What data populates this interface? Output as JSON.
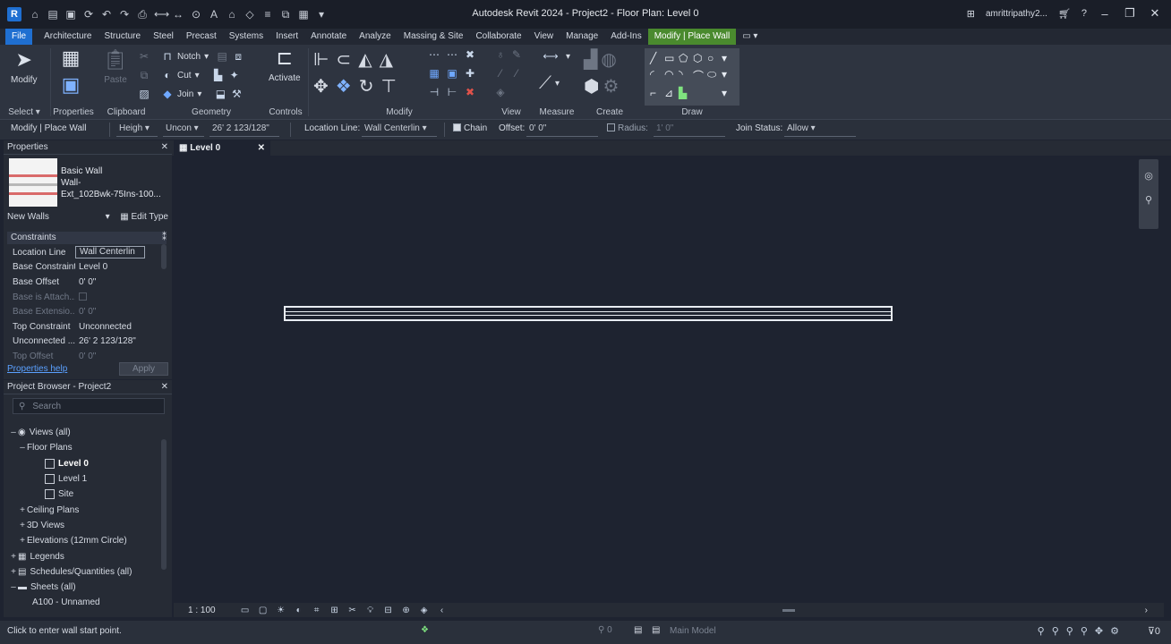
{
  "titlebar": {
    "logo": "R",
    "title": "Autodesk Revit 2024 - Project2 - Floor Plan: Level 0",
    "user": "amrittripathy2...",
    "qat_icons": [
      "open-icon",
      "save-icon",
      "sync-icon",
      "undo-icon",
      "redo-icon",
      "print-icon",
      "measure-icon",
      "text-icon",
      "home-icon",
      "close-views-icon",
      "switch-windows-icon"
    ],
    "minimize": "–",
    "restore": "❐",
    "close": "✕"
  },
  "tabs": [
    "File",
    "Architecture",
    "Structure",
    "Steel",
    "Precast",
    "Systems",
    "Insert",
    "Annotate",
    "Analyze",
    "Massing & Site",
    "Collaborate",
    "View",
    "Manage",
    "Add-Ins",
    "Modify | Place Wall"
  ],
  "ribbon": {
    "modify_label": "Modify",
    "select_label": "Select",
    "properties_label": "Properties",
    "clipboard_label": "Clipboard",
    "paste_label": "Paste",
    "notch_label": "Notch",
    "cut_label": "Cut",
    "join_label": "Join",
    "geometry_label": "Geometry",
    "activate_label": "Activate",
    "controls_label": "Controls",
    "modify_group_label": "Modify",
    "view_label": "View",
    "measure_label": "Measure",
    "create_label": "Create",
    "draw_label": "Draw"
  },
  "optbar": {
    "context": "Modify | Place Wall",
    "height_mode": "Heigh",
    "height_target": "Uncon",
    "height_value": "26'  2 123/128\"",
    "location_line_label": "Location Line:",
    "location_line_value": "Wall Centerlin",
    "chain_label": "Chain",
    "offset_label": "Offset:",
    "offset_value": "0'  0\"",
    "radius_label": "Radius:",
    "radius_value": "1'  0\"",
    "join_status_label": "Join Status:",
    "join_status_value": "Allow"
  },
  "properties": {
    "title": "Properties",
    "type_family": "Basic Wall",
    "type_name_1": "Wall-",
    "type_name_2": "Ext_102Bwk-75Ins-100...",
    "instance_filter": "New Walls",
    "edit_type": "Edit Type",
    "category": "Constraints",
    "rows": [
      {
        "key": "Location Line",
        "value": "Wall Centerlin",
        "dim": false
      },
      {
        "key": "Base Constraint",
        "value": "Level 0",
        "dim": false
      },
      {
        "key": "Base Offset",
        "value": "0'  0\"",
        "dim": false
      },
      {
        "key": "Base is Attach...",
        "value": "",
        "dim": true
      },
      {
        "key": "Base Extensio...",
        "value": "0'  0\"",
        "dim": true
      },
      {
        "key": "Top Constraint",
        "value": "Unconnected",
        "dim": false
      },
      {
        "key": "Unconnected ...",
        "value": "26'  2 123/128\"",
        "dim": false
      },
      {
        "key": "Top Offset",
        "value": "0'  0\"",
        "dim": true
      }
    ],
    "help_link": "Properties help",
    "apply": "Apply"
  },
  "browser": {
    "title": "Project Browser - Project2",
    "search_placeholder": "Search",
    "nodes": [
      {
        "label": "Views (all)",
        "exp": "–",
        "indent": 0
      },
      {
        "label": "Floor Plans",
        "exp": "–",
        "indent": 1
      },
      {
        "label": "Level 0",
        "exp": "",
        "indent": 2,
        "active": true
      },
      {
        "label": "Level 1",
        "exp": "",
        "indent": 2
      },
      {
        "label": "Site",
        "exp": "",
        "indent": 2
      },
      {
        "label": "Ceiling Plans",
        "exp": "+",
        "indent": 1
      },
      {
        "label": "3D Views",
        "exp": "+",
        "indent": 1
      },
      {
        "label": "Elevations (12mm Circle)",
        "exp": "+",
        "indent": 1
      },
      {
        "label": "Legends",
        "exp": "+",
        "indent": 0
      },
      {
        "label": "Schedules/Quantities (all)",
        "exp": "+",
        "indent": 0
      },
      {
        "label": "Sheets (all)",
        "exp": "–",
        "indent": 0
      },
      {
        "label": "A100 - Unnamed",
        "exp": "",
        "indent": 1
      }
    ]
  },
  "view": {
    "tab_label": "Level 0",
    "scale": "1 : 100"
  },
  "status": {
    "prompt": "Click to enter wall start point.",
    "model": "Main Model",
    "filter_count": "0"
  }
}
